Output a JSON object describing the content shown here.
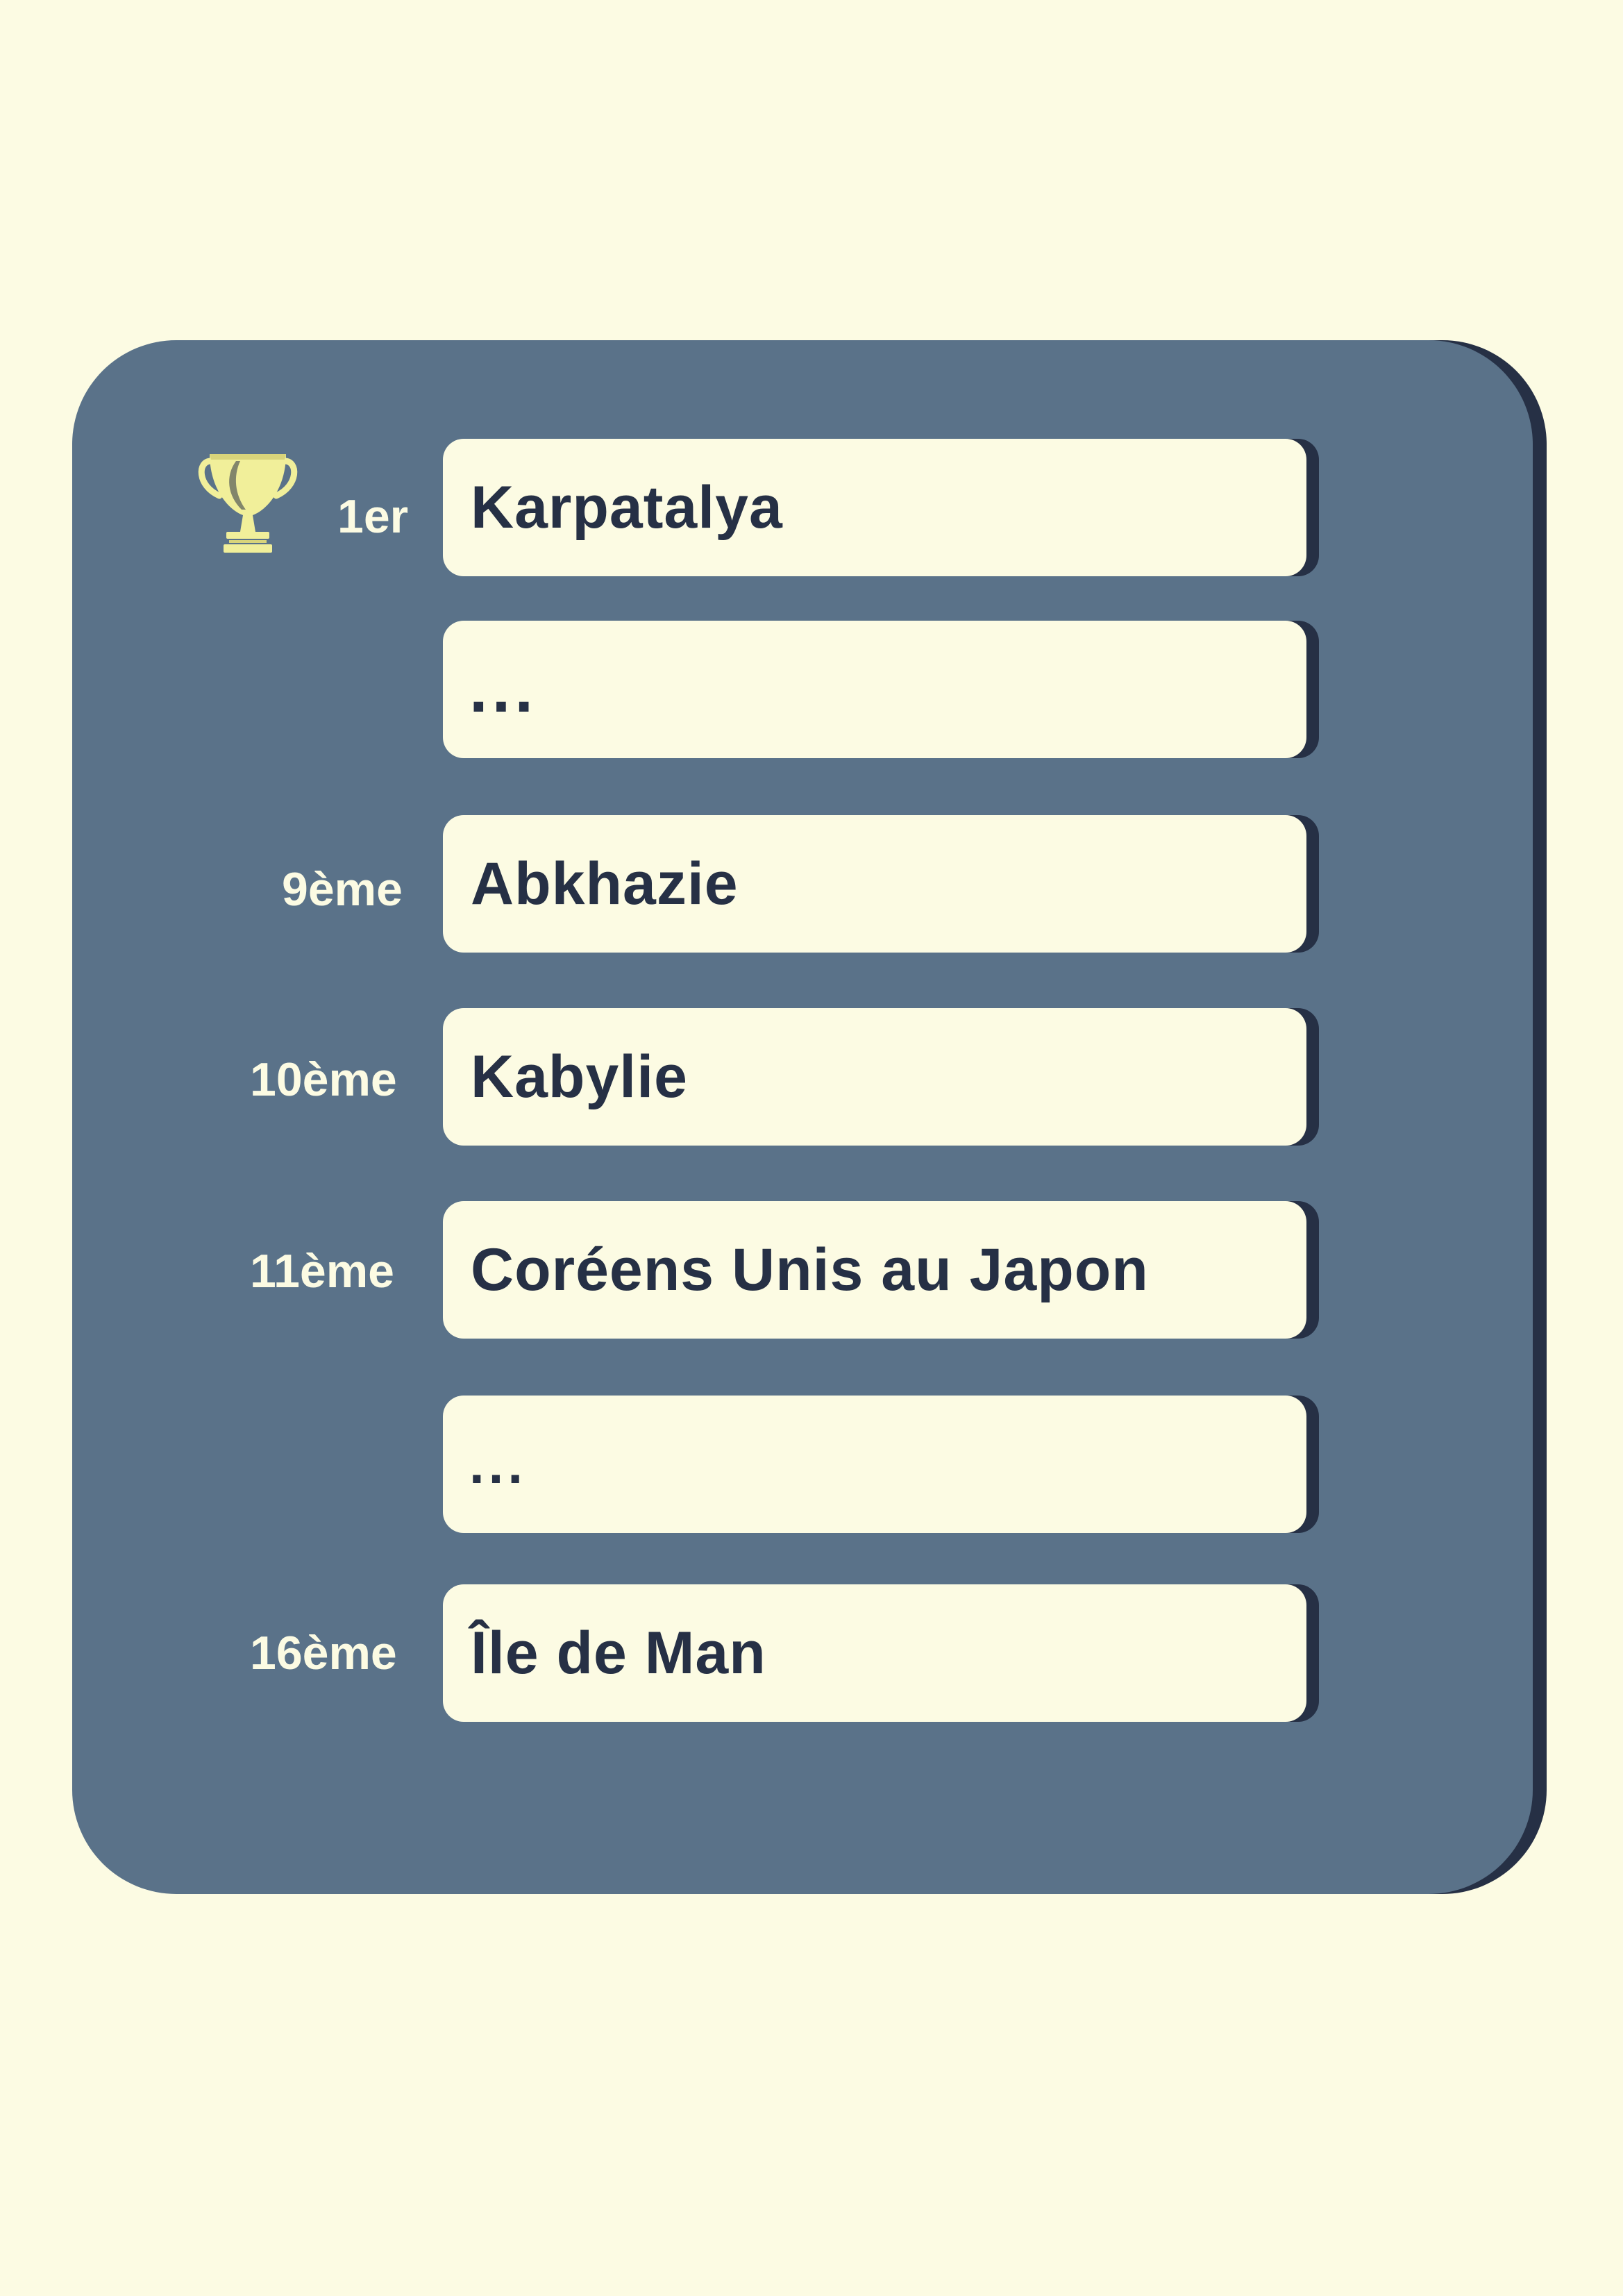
{
  "colors": {
    "page_background": "#fcfbe3",
    "panel": "#5a7289",
    "panel_shadow": "#263045",
    "row_background": "#fcfbe3",
    "text_dark": "#263045",
    "trophy": "#f1ef9a"
  },
  "icons": {
    "trophy": "trophy-icon"
  },
  "rows": [
    {
      "rank": "1er",
      "name": "Karpatalya"
    },
    {
      "rank": "",
      "name": "..."
    },
    {
      "rank": "9ème",
      "name": "Abkhazie"
    },
    {
      "rank": "10ème",
      "name": "Kabylie"
    },
    {
      "rank": "11ème",
      "name": "Coréens Unis au Japon"
    },
    {
      "rank": "",
      "name": "..."
    },
    {
      "rank": "16ème",
      "name": "Île de Man"
    }
  ]
}
